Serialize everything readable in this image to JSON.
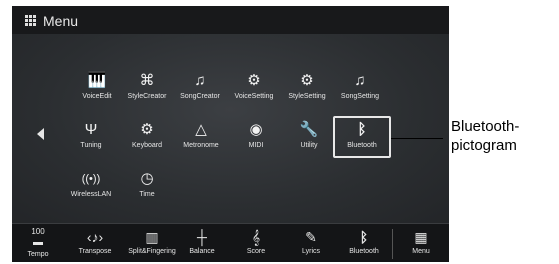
{
  "window": {
    "title": "Menu"
  },
  "menu_items": [
    {
      "label": "VoiceEdit",
      "icon": "voice-edit-icon",
      "glyph": "🎹"
    },
    {
      "label": "StyleCreator",
      "icon": "style-creator-icon",
      "glyph": "⌘"
    },
    {
      "label": "SongCreator",
      "icon": "song-creator-icon",
      "glyph": "♫"
    },
    {
      "label": "VoiceSetting",
      "icon": "voice-setting-icon",
      "glyph": "⚙"
    },
    {
      "label": "StyleSetting",
      "icon": "style-setting-icon",
      "glyph": "⚙"
    },
    {
      "label": "SongSetting",
      "icon": "song-setting-icon",
      "glyph": "♫"
    },
    {
      "label": "Tuning",
      "icon": "tuning-fork-icon",
      "glyph": "Ψ"
    },
    {
      "label": "Keyboard",
      "icon": "keyboard-icon",
      "glyph": "⚙"
    },
    {
      "label": "Metronome",
      "icon": "metronome-icon",
      "glyph": "△"
    },
    {
      "label": "MIDI",
      "icon": "midi-icon",
      "glyph": "◉"
    },
    {
      "label": "Utility",
      "icon": "wrench-icon",
      "glyph": "🔧"
    },
    {
      "label": "Bluetooth",
      "icon": "bluetooth-icon",
      "glyph": "ᛒ"
    },
    {
      "label": "WirelessLAN",
      "icon": "wifi-icon",
      "glyph": "((•))"
    },
    {
      "label": "Time",
      "icon": "clock-icon",
      "glyph": "◷"
    }
  ],
  "bottom_bar": {
    "tempo_value": "100",
    "items": [
      {
        "label": "Tempo",
        "icon": "tempo-icon",
        "glyph": "▬"
      },
      {
        "label": "Transpose",
        "icon": "transpose-icon",
        "glyph": "‹♪›"
      },
      {
        "label": "Split&Fingering",
        "icon": "split-fingering-icon",
        "glyph": "▥"
      },
      {
        "label": "Balance",
        "icon": "balance-slider-icon",
        "glyph": "┼"
      },
      {
        "label": "Score",
        "icon": "treble-clef-icon",
        "glyph": "𝄞"
      },
      {
        "label": "Lyrics",
        "icon": "lyrics-icon",
        "glyph": "✎"
      },
      {
        "label": "Bluetooth",
        "icon": "bluetooth-icon",
        "glyph": "ᛒ"
      },
      {
        "label": "Menu",
        "icon": "grid-menu-icon",
        "glyph": "▦"
      }
    ]
  },
  "callout": {
    "line1": "Bluetooth-",
    "line2": "pictogram"
  }
}
